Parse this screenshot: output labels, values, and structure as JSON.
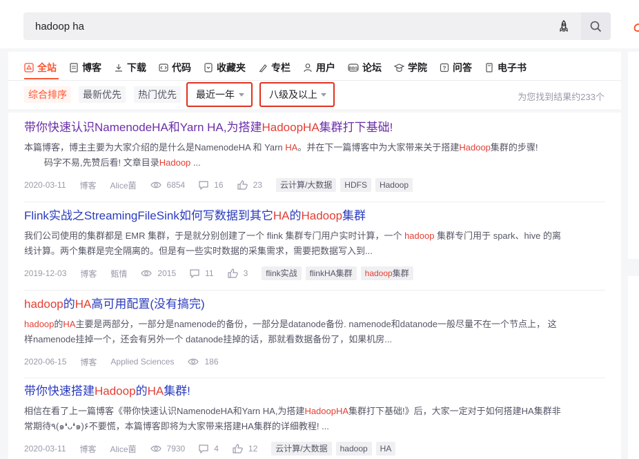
{
  "search": {
    "query": "hadoop ha"
  },
  "tabs": [
    {
      "label": "全站",
      "icon": "site-icon"
    },
    {
      "label": "博客",
      "icon": "blog-icon"
    },
    {
      "label": "下载",
      "icon": "download-icon"
    },
    {
      "label": "代码",
      "icon": "code-icon"
    },
    {
      "label": "收藏夹",
      "icon": "favorites-icon"
    },
    {
      "label": "专栏",
      "icon": "column-icon"
    },
    {
      "label": "用户",
      "icon": "user-icon"
    },
    {
      "label": "论坛",
      "icon": "forum-icon"
    },
    {
      "label": "学院",
      "icon": "academy-icon"
    },
    {
      "label": "问答",
      "icon": "qa-icon"
    },
    {
      "label": "电子书",
      "icon": "ebook-icon"
    }
  ],
  "filters": {
    "sort_all": "综合排序",
    "sort_new": "最新优先",
    "sort_hot": "热门优先",
    "time": "最近一年",
    "level": "八级及以上",
    "count": "为您找到结果约233个"
  },
  "results": [
    {
      "title": [
        "带你快速认识NamenodeHA和Yarn HA,为搭建",
        "HadoopHA",
        "集群打下基础!"
      ],
      "desc1": [
        "本篇博客，博主主要为大家介绍的是什么是NamenodeHA 和 Yarn ",
        "HA",
        "。并在下一篇博客中为大家带来关于搭建",
        "Hadoop",
        "集群的步骤!"
      ],
      "desc2": [
        "        码字不易,先赞后看! 文章目录",
        "Hadoop",
        " ..."
      ],
      "date": "2020-03-11",
      "type": "博客",
      "author": "Alice菌",
      "views": "6854",
      "comments": "16",
      "likes": "23",
      "tags": [
        "云计算/大数据",
        "HDFS",
        "Hadoop"
      ]
    },
    {
      "title": [
        "Flink实战之StreamingFileSink如何写数据到其它",
        "HA",
        "的",
        "Hadoop",
        "集群"
      ],
      "desc1": [
        "我们公司使用的集群都是 EMR 集群，于是就分别创建了一个 flink 集群专门用户实时计算，一个 ",
        "hadoop",
        " 集群专门用于 spark、hive 的离"
      ],
      "desc2": [
        "线计算。两个集群是完全隔离的。但是有一些实时数据的采集需求，需要把数据写入到..."
      ],
      "date": "2019-12-03",
      "type": "博客",
      "author": "甄情",
      "views": "2015",
      "comments": "11",
      "likes": "3",
      "tags": [
        "flink实战",
        "flinkHA集群"
      ],
      "tag_hl": [
        "hadoop",
        "集群"
      ]
    },
    {
      "title": [
        "hadoop",
        "的",
        "HA",
        "高可用配置(没有搞完)"
      ],
      "desc1": [
        "hadoop",
        "的",
        "HA",
        "主要是两部分，一部分是namenode的备份，一部分是datanode备份.   namenode和datanode一般尽量不在一个节点上， 这"
      ],
      "desc2": [
        "样namenode挂掉一个，还会有另外一个 datanode挂掉的话，那就看数据备份了，如果机房..."
      ],
      "date": "2020-06-15",
      "type": "博客",
      "author": "Applied Sciences",
      "views": "186"
    },
    {
      "title": [
        "带你快速搭建",
        "Hadoop",
        "的",
        "HA",
        "集群!"
      ],
      "desc1": [
        "相信在看了上一篇博客《带你快速认识NamenodeHA和Yarn HA,为搭建",
        "HadoopHA",
        "集群打下基础!》后，大家一定对于如何搭建HA集群非"
      ],
      "desc2": [
        "常期待٩(๑❛ᴗ❛๑)۶不要慌，本篇博客即将为大家带来搭建HA集群的详细教程!  ..."
      ],
      "date": "2020-03-11",
      "type": "博客",
      "author": "Alice菌",
      "views": "7930",
      "comments": "4",
      "likes": "12",
      "tags": [
        "云计算/大数据"
      ],
      "tags_hl": [
        "hadoop",
        "HA"
      ]
    }
  ],
  "colors": {
    "accent": "#fc5531",
    "highlight": "#e33e33",
    "link": "#2a3bbd",
    "visited": "#6b2ea8"
  }
}
